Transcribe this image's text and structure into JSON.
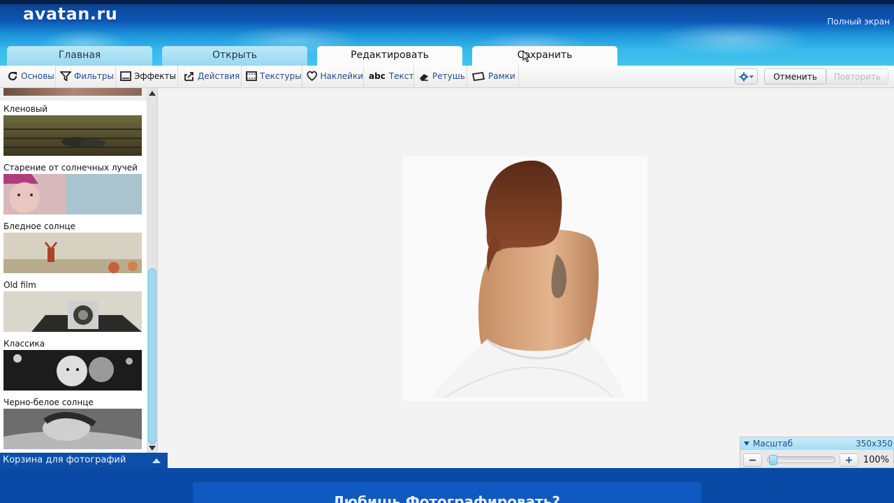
{
  "header": {
    "logo": "avatan.ru",
    "fullscreen": "Полный экран"
  },
  "tabs": [
    {
      "label": "Главная"
    },
    {
      "label": "Открыть"
    },
    {
      "label": "Редактировать",
      "active": true
    },
    {
      "label": "Сохранить"
    }
  ],
  "toolbar": {
    "items": [
      {
        "label": "Основы",
        "icon": "refresh-icon"
      },
      {
        "label": "Фильтры",
        "icon": "funnel-icon"
      },
      {
        "label": "Эффекты",
        "icon": "frame-icon"
      },
      {
        "label": "Действия",
        "icon": "action-icon"
      },
      {
        "label": "Текстуры",
        "icon": "film-icon"
      },
      {
        "label": "Наклейки",
        "icon": "heart-icon"
      },
      {
        "label": "Текст",
        "icon": "abc-icon"
      },
      {
        "label": "Ретушь",
        "icon": "eraser-icon"
      },
      {
        "label": "Рамки",
        "icon": "frames-icon"
      }
    ],
    "undo": "Отменить",
    "redo": "Повторить"
  },
  "filters": [
    {
      "label": "Кленовый"
    },
    {
      "label": "Старение от солнечных лучей"
    },
    {
      "label": "Бледное солнце"
    },
    {
      "label": "Old film"
    },
    {
      "label": "Классика"
    },
    {
      "label": "Черно-белое солнце"
    }
  ],
  "basket": "Корзина для фотографий",
  "zoom": {
    "label": "Масштаб",
    "size": "350x350",
    "percent": "100%",
    "level": 0.02,
    "minus": "−",
    "plus": "+"
  },
  "footer": {
    "text": "Любишь Фотографировать?"
  },
  "colors": {
    "accent": "#0d4fa8",
    "link": "#1f4e8c",
    "sky": "#45c6ee"
  }
}
